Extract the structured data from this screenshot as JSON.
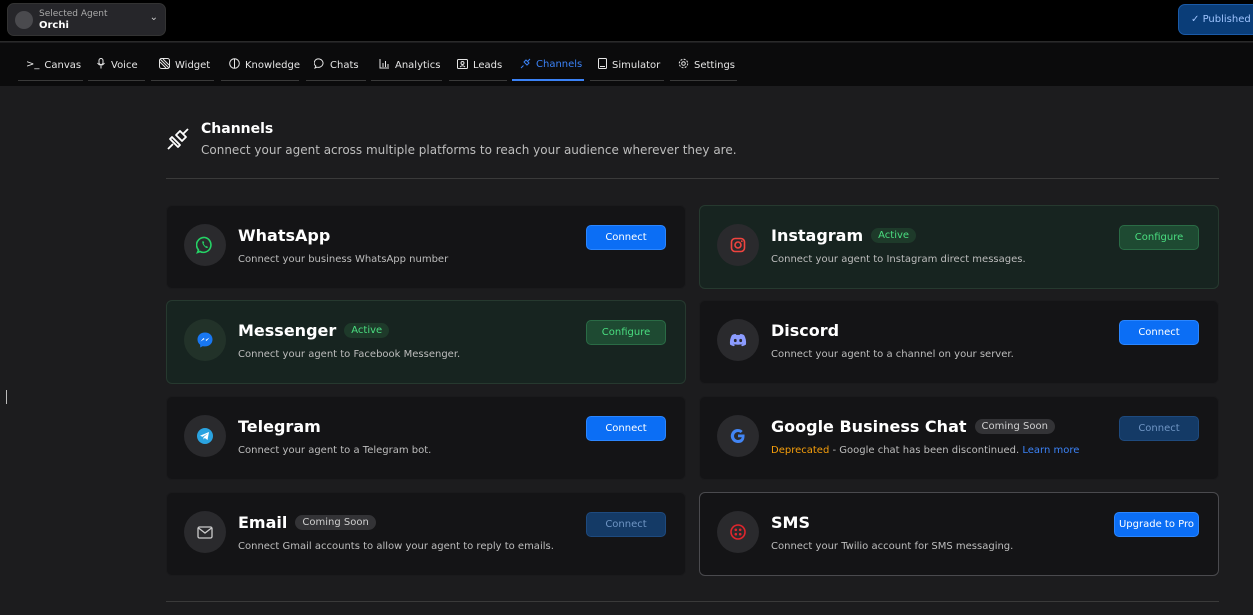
{
  "topbar": {
    "agent_label": "Selected Agent",
    "agent_name": "Orchi",
    "published_label": "Published"
  },
  "tabs": [
    {
      "label": "Canvas",
      "icon": "terminal-icon"
    },
    {
      "label": "Voice",
      "icon": "mic-icon"
    },
    {
      "label": "Widget",
      "icon": "widget-icon"
    },
    {
      "label": "Knowledge",
      "icon": "brain-icon"
    },
    {
      "label": "Chats",
      "icon": "chat-bubble-icon"
    },
    {
      "label": "Analytics",
      "icon": "bar-chart-icon"
    },
    {
      "label": "Leads",
      "icon": "contact-card-icon"
    },
    {
      "label": "Channels",
      "icon": "plug-icon"
    },
    {
      "label": "Simulator",
      "icon": "device-icon"
    },
    {
      "label": "Settings",
      "icon": "gear-icon"
    }
  ],
  "header": {
    "title": "Channels",
    "subtitle": "Connect your agent across multiple platforms to reach your audience wherever they are."
  },
  "channels": [
    {
      "name": "WhatsApp",
      "description": "Connect your business WhatsApp number",
      "button": "Connect",
      "icon_color": "#25d366"
    },
    {
      "name": "Instagram",
      "badge": "Active",
      "description": "Connect your agent to Instagram direct messages.",
      "button": "Configure",
      "icon_color": "#f0443f"
    },
    {
      "name": "Messenger",
      "badge": "Active",
      "description": "Connect your agent to Facebook Messenger.",
      "button": "Configure",
      "icon_color": "#1877f2"
    },
    {
      "name": "Discord",
      "description": "Connect your agent to a channel on your server.",
      "button": "Connect",
      "icon_color": "#5865f2"
    },
    {
      "name": "Telegram",
      "description": "Connect your agent to a Telegram bot.",
      "button": "Connect",
      "icon_color": "#2aa3e0"
    },
    {
      "name": "Google Business Chat",
      "badge": "Coming Soon",
      "description_deprecated": "Deprecated",
      "description": " - Google chat has been discontinued. ",
      "learn_more": "Learn more",
      "button": "Connect",
      "icon_color": "#4285f4"
    },
    {
      "name": "Email",
      "badge": "Coming Soon",
      "description": "Connect Gmail accounts to allow your agent to reply to emails.",
      "button": "Connect",
      "icon_color": "#cccccc"
    },
    {
      "name": "SMS",
      "description": "Connect your Twilio account for SMS messaging.",
      "button": "Upgrade to Pro",
      "icon_color": "#e0262d"
    }
  ],
  "colors": {
    "accent": "#3b82f6",
    "active_green": "#4ade80",
    "deprecated": "#f59e0b"
  }
}
